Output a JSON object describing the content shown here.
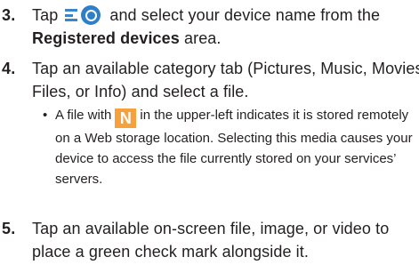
{
  "steps": [
    {
      "number": "3.",
      "line1_before": "Tap",
      "line1_after": "and select your device name from the",
      "line2_bold": "Registered devices",
      "line2_after": " area."
    },
    {
      "number": "4.",
      "line1": "Tap an available category tab (Pictures, Music, Movies,",
      "line2": "Files, or Info) and select a file.",
      "bullet": {
        "symbol": "•",
        "line1_before": "A file with",
        "icon_letter": "N",
        "line1_after": "in the upper-left indicates it is stored remotely",
        "line2": "on a Web storage location. Selecting this media causes your",
        "line3": "device to access the file currently stored on your services’",
        "line4": "servers."
      }
    },
    {
      "number": "5.",
      "line1": "Tap an available on-screen file, image, or video to",
      "line2": "place a green check mark alongside it."
    }
  ],
  "icons": {
    "menu_icon": "menu-lines-icon",
    "device_icon": "allshare-circle-icon",
    "web_storage_icon": "n-badge-icon"
  },
  "colors": {
    "text": "#231f20",
    "menu_icon_blue": "#2f7fc8",
    "n_badge_orange": "#f6a13b"
  }
}
